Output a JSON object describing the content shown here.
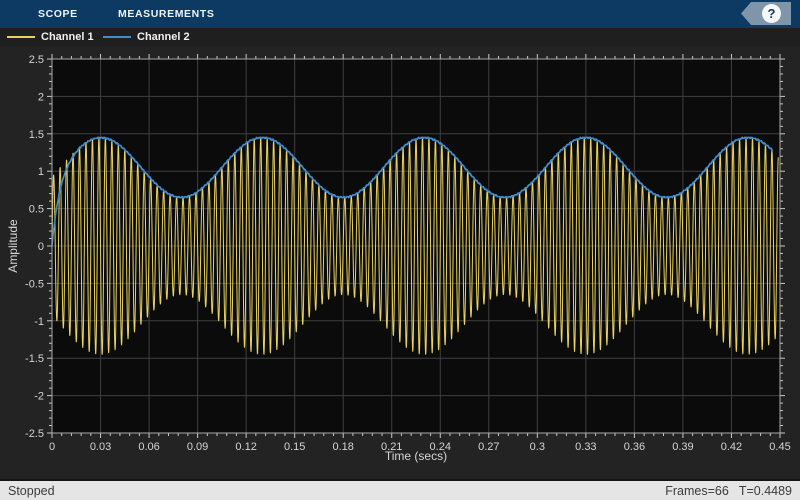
{
  "window": {
    "bg": "#232323"
  },
  "toolbar": {
    "bg": "#0d3a62",
    "tabs": [
      "SCOPE",
      "MEASUREMENTS"
    ],
    "help_glyph": "?",
    "help_button_color": "#7e95aa"
  },
  "status": {
    "state": "Stopped",
    "frames": "Frames=66",
    "time": "T=0.4489"
  },
  "chart_data": {
    "type": "line",
    "title": "",
    "xlabel": "Time (secs)",
    "ylabel": "Amplitude",
    "xlim": [
      0,
      0.45
    ],
    "ylim": [
      -2.5,
      2.5
    ],
    "grid": true,
    "legend_position": "top-left",
    "plot_bg": "#0b0b0b",
    "grid_color": "#3f3f3f",
    "frame_color": "#a9a9a9",
    "tick_color": "#c9c9c9",
    "tick_label_color": "#d4d4d4",
    "x_ticks": [
      0,
      0.03,
      0.06,
      0.09,
      0.12,
      0.15,
      0.18,
      0.21,
      0.24,
      0.27,
      0.3,
      0.33,
      0.36,
      0.39,
      0.42,
      0.45
    ],
    "x_tick_labels": [
      "0",
      "0.03",
      "0.06",
      "0.09",
      "0.12",
      "0.15",
      "0.18",
      "0.21",
      "0.24",
      "0.27",
      "0.3",
      "0.33",
      "0.36",
      "0.39",
      "0.42",
      "0.45"
    ],
    "y_ticks": [
      2.5,
      2,
      1.5,
      1,
      0.5,
      0,
      -0.5,
      -1,
      -1.5,
      -2,
      -2.5
    ],
    "y_tick_labels": [
      "2.5",
      "2",
      "1.5",
      "1",
      "0.5",
      "0",
      "-0.5",
      "-1",
      "-1.5",
      "-2",
      "-2.5"
    ],
    "x_minor_step": 0.006,
    "y_minor_step": 0.1,
    "series": [
      {
        "name": "Channel 1",
        "color": "#e9d35f",
        "kind": "am-modulated-sine",
        "carrier_hz": 250,
        "modulation_hz": 10,
        "envelope_mean": 1.05,
        "envelope_depth": 0.4,
        "envelope_peak_time_s": 0.03,
        "envelope_max": 1.45,
        "envelope_min": 0.65,
        "t_start": 0,
        "t_end": 0.4489,
        "line_width": 1
      },
      {
        "name": "Channel 2",
        "color": "#3f8cce",
        "kind": "detected-envelope",
        "modulation_hz": 10,
        "envelope_mean": 1.05,
        "envelope_depth": 0.4,
        "envelope_peak_time_s": 0.03,
        "startup_tau_s": 0.004,
        "t_start": 0,
        "t_end": 0.4455,
        "line_width": 1.6
      }
    ]
  }
}
